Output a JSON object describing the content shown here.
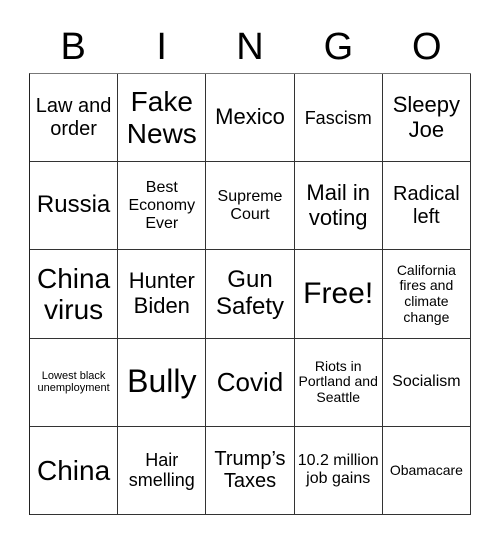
{
  "header": [
    "B",
    "I",
    "N",
    "G",
    "O"
  ],
  "cells": [
    "Law and order",
    "Fake News",
    "Mexico",
    "Fascism",
    "Sleepy Joe",
    "Russia",
    "Best Economy Ever",
    "Supreme Court",
    "Mail in voting",
    "Radical left",
    "China virus",
    "Hunter Biden",
    "Gun Safety",
    "Free!",
    "California fires and climate change",
    "Lowest black unemployment",
    "Bully",
    "Covid",
    "Riots in Portland and Seattle",
    "Socialism",
    "China",
    "Hair smelling",
    "Trump’s Taxes",
    "10.2 million job gains",
    "Obamacare"
  ]
}
